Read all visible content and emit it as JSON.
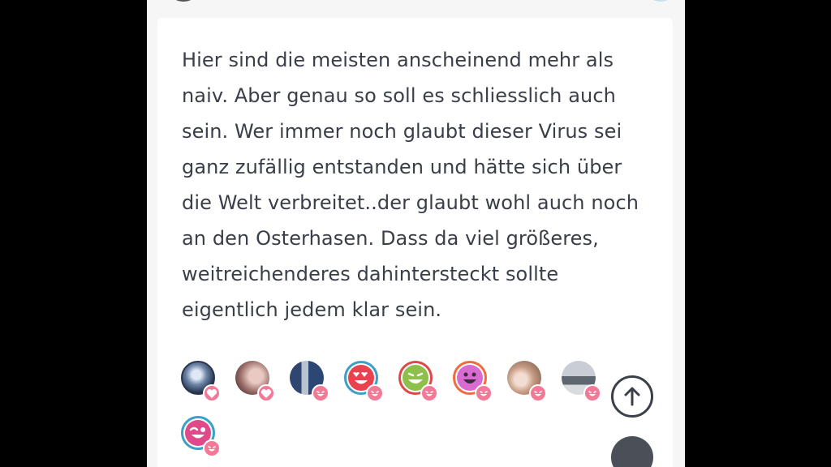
{
  "post": {
    "lines": [
      "Hier sind die meisten anscheinend mehr als",
      "naiv. Aber genau so soll es schliesslich auch",
      "sein. Wer immer noch glaubt dieser Virus sei",
      "ganz zufällig entstanden und hätte sich über",
      "die Welt verbreitet..der glaubt wohl auch noch",
      "an den Osterhasen. Dass da viel größeres,",
      "weitreichenderes dahintersteckt sollte",
      "eigentlich jedem klar sein."
    ]
  },
  "reactions": [
    {
      "avatar": "photo-avatar-night-sky",
      "reaction": "heart-icon"
    },
    {
      "avatar": "photo-avatar-face",
      "reaction": "heart-icon"
    },
    {
      "avatar": "photo-avatar-statue",
      "reaction": "laugh-icon"
    },
    {
      "avatar": "emoji-avatar-heart-eyes",
      "reaction": "laugh-icon"
    },
    {
      "avatar": "emoji-avatar-grin-green",
      "reaction": "laugh-icon"
    },
    {
      "avatar": "emoji-avatar-smile-purple",
      "reaction": "laugh-icon"
    },
    {
      "avatar": "photo-avatar-food",
      "reaction": "laugh-icon"
    },
    {
      "avatar": "photo-avatar-beach",
      "reaction": "laugh-icon"
    },
    {
      "avatar": "emoji-avatar-wink-pink",
      "reaction": "laugh-icon"
    }
  ],
  "colors": {
    "text": "#3a3e48",
    "reaction_badge": "#f27a97",
    "card": "#ffffff",
    "panel": "#f6f6f7"
  },
  "icons": {
    "scroll_top": "arrow-up-circle-icon"
  }
}
